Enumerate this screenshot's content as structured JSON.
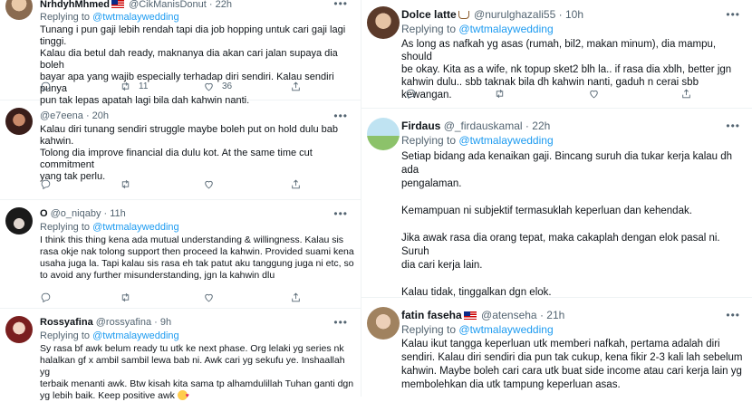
{
  "left": [
    {
      "name": "NrhdyhMhmed",
      "handle": "@CikManisDonut",
      "time": "22h",
      "reply_prefix": "Replying to",
      "reply_handle": "@twtmalaywedding",
      "text": "Tunang i pun gaji lebih rendah tapi dia job hopping untuk cari gaji lagi tinggi.\nKalau dia betul dah ready, maknanya dia akan cari jalan supaya dia boleh\nbayar apa yang wajib especially terhadap diri sendiri. Kalau sendiri punya\npun tak lepas apatah lagi bila dah kahwin nanti.",
      "retweets": "11",
      "likes": "36"
    },
    {
      "name": "",
      "handle": "@e7eena",
      "time": "20h",
      "reply_prefix": "",
      "reply_handle": "",
      "text": "Kalau diri tunang sendiri struggle maybe boleh put on hold dulu bab kahwin.\nTolong dia improve financial dia dulu kot. At the same time cut commitment\nyang tak perlu.",
      "retweets": "",
      "likes": ""
    },
    {
      "name": "O",
      "handle": "@o_niqaby",
      "time": "11h",
      "reply_prefix": "Replying to",
      "reply_handle": "@twtmalaywedding",
      "text": "I think this thing kena ada mutual understanding & willingness. Kalau sis\nrasa okje nak tolong support then proceed la kahwin. Provided suami kena\nusaha juga la. Tapi kalau sis rasa eh tak patut aku tanggung juga ni etc, so\nto avoid any further misunderstanding, jgn la kahwin dlu",
      "retweets": "",
      "likes": ""
    },
    {
      "name": "Rossyafina",
      "handle": "@rossyafina",
      "time": "9h",
      "reply_prefix": "Replying to",
      "reply_handle": "@twtmalaywedding",
      "text": "Sy rasa bf awk belum ready tu utk ke next phase. Org lelaki yg series nk\nhalalkan gf x ambil sambil lewa bab ni. Awk cari yg sekufu ye. Inshaallah yg\nterbaik menanti awk. Btw kisah kita sama tp alhamdulillah Tuhan ganti dgn\nyg lebih baik. Keep positive awk",
      "retweets": "",
      "likes": ""
    }
  ],
  "right": [
    {
      "name": "Dolce latte",
      "handle": "@nurulghazali55",
      "time": "10h",
      "reply_prefix": "Replying to",
      "reply_handle": "@twtmalaywedding",
      "text": "As long as nafkah yg asas (rumah, bil2, makan minum), dia mampu, should\nbe okay. Kita as a wife, nk topup sket2 blh la.. if rasa dia xblh, better jgn\nkahwin dulu.. sbb taknak bila dh kahwin nanti, gaduh n cerai sbb kewangan.",
      "retweets": "",
      "likes": ""
    },
    {
      "name": "Firdaus",
      "handle": "@_firdauskamal",
      "time": "22h",
      "reply_prefix": "Replying to",
      "reply_handle": "@twtmalaywedding",
      "text": "Setiap bidang ada kenaikan gaji. Bincang suruh dia tukar kerja kalau dh ada\npengalaman.\n\nKemampuan ni subjektif termasuklah keperluan dan kehendak.\n\nJika awak rasa dia orang tepat, maka cakaplah dengan elok pasal ni. Suruh\ndia cari kerja lain.\n\nKalau tidak, tinggalkan dgn elok.",
      "retweets": "",
      "likes": ""
    },
    {
      "name": "fatin faseha",
      "handle": "@atenseha",
      "time": "21h",
      "reply_prefix": "Replying to",
      "reply_handle": "@twtmalaywedding",
      "text": "Kalau ikut tangga keperluan utk memberi nafkah, pertama adalah diri\nsendiri. Kalau diri sendiri dia pun tak cukup, kena fikir 2-3 kali lah sebelum\nkahwin. Maybe boleh cari cara utk buat side income atau cari kerja lain yg\nmembolehkan dia utk tampung keperluan asas.",
      "retweets": "",
      "likes": ""
    }
  ],
  "icons": {
    "reply": "reply-icon",
    "retweet": "retweet-icon",
    "like": "heart-icon",
    "share": "share-icon",
    "more": "more-icon"
  },
  "colors": {
    "accent": "#1d9bf0",
    "muted": "#536471",
    "text": "#0f1419"
  }
}
